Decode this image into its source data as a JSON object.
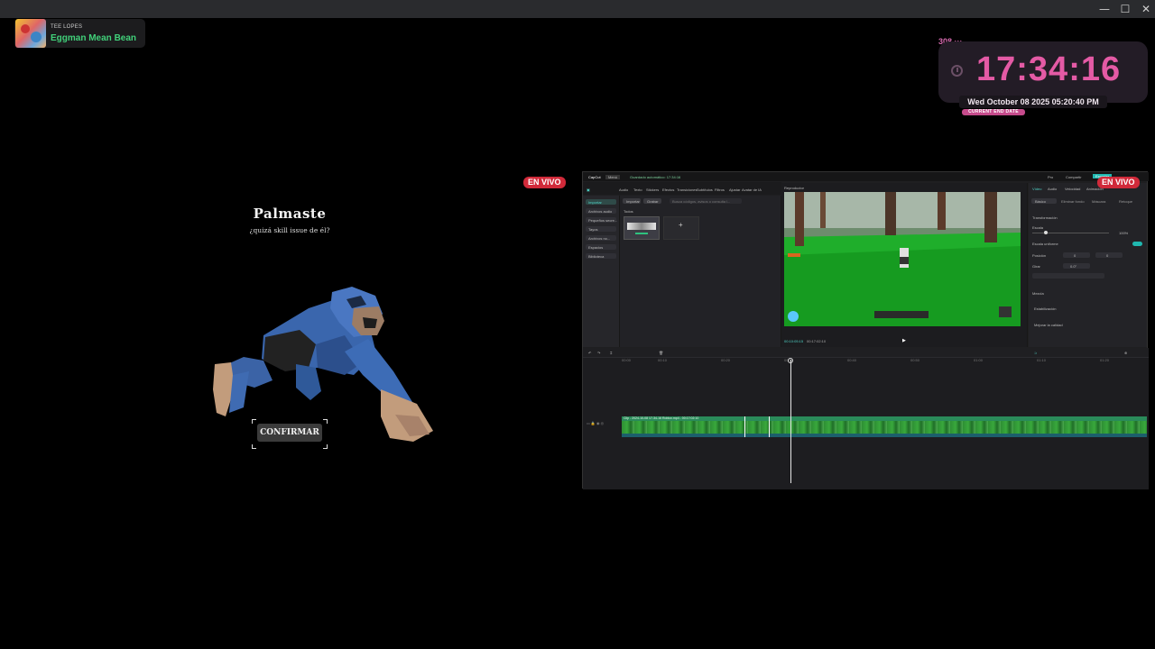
{
  "window": {
    "minimize_glyph": "—",
    "maximize_glyph": "☐",
    "close_glyph": "✕"
  },
  "now_playing": {
    "artist": "TEE LOPES",
    "title": "Eggman Mean Bean",
    "art_icon": "album-art"
  },
  "clock_widget": {
    "counter": "308 ···",
    "time": "17:34:16",
    "date": "Wed October 08 2025 05:20:40 PM",
    "date_label": "CURRENT END DATE",
    "accent": "#e45aa5"
  },
  "game": {
    "title": "Palmaste",
    "subtitle": "¿quizá skill issue de él?",
    "confirm_label": "CONFIRMAR"
  },
  "live_badge": {
    "label": "EN VIVO",
    "color": "#d12a3a"
  },
  "capcut": {
    "app_name": "CapCut",
    "menu": "Menú",
    "save_status": "Guardado automático: 17:34:16",
    "export_button": "Exportar",
    "share_button": "Compartir",
    "pro_button": "Pro",
    "toolbar": [
      "Audio",
      "Texto",
      "Stickers",
      "Efectos",
      "Transiciones",
      "Subtítulos",
      "Filtros",
      "Ajustar",
      "Avatar de IA"
    ],
    "left_tabs": [
      "Importar",
      "Archivos audio",
      "Pequeños secre...",
      "Tayos",
      "Archivos no...",
      "Espacios",
      "Biblioteca"
    ],
    "import_button": "Importar",
    "record_button": "Grabar",
    "search_placeholder": "Busca códigos, avisos o consulta l...",
    "media_section": "Todos",
    "player_title": "Reproductor",
    "timecode_current": "00:10:05:15",
    "timecode_total": "00:17:02:10",
    "props_tabs": [
      "Vídeo",
      "Audio",
      "Velocidad",
      "Animación"
    ],
    "props_subtabs": [
      "Básico",
      "Eliminar fondo",
      "Máscara",
      "Retoque"
    ],
    "props_rows": [
      "Transformación",
      "Escala",
      "Escala uniforme",
      "Posición",
      "Girar",
      "Mezcla",
      "Estabilización",
      "Mejorar la calidad"
    ],
    "scale_value": "100%",
    "pos_x": "0",
    "pos_y": "0",
    "rotate_value": "0.0°",
    "clip_label": "Clip - 2024-10-08 17-34-16 Roblox.mp4 - 00:17:02:10",
    "ruler": [
      "00:00",
      "00:10",
      "00:20",
      "00:30",
      "00:40",
      "00:50",
      "01:00",
      "01:10",
      "01:20"
    ]
  }
}
